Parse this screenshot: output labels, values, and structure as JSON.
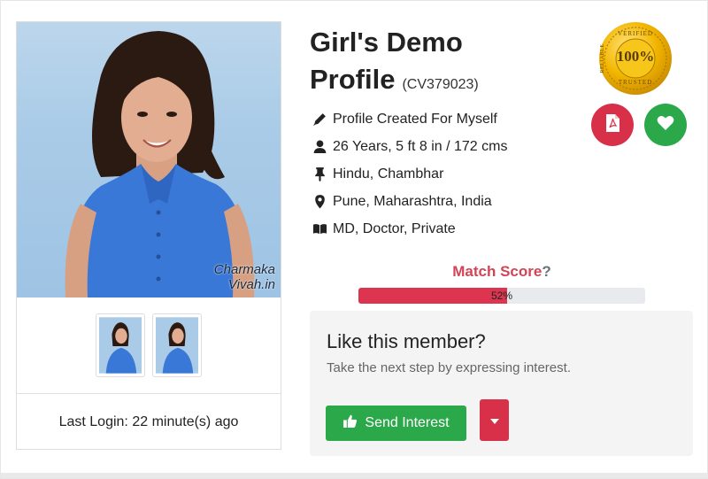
{
  "profile": {
    "name": "Girl's Demo Profile",
    "id": "(CV379023)",
    "photo_watermark_line1": "Charmaka",
    "photo_watermark_line2": "Vivah.in",
    "details": [
      {
        "icon": "pen-icon",
        "text": "Profile Created For Myself"
      },
      {
        "icon": "user-icon",
        "text": "26 Years, 5 ft 8 in / 172 cms"
      },
      {
        "icon": "pin-icon",
        "text": "Hindu, Chambhar"
      },
      {
        "icon": "map-marker-icon",
        "text": "Pune, Maharashtra, India"
      },
      {
        "icon": "book-icon",
        "text": "MD, Doctor, Private"
      }
    ],
    "last_login": "Last Login: 22 minute(s) ago"
  },
  "badge": {
    "top": "VERIFIED",
    "center": "100%",
    "bottom": "TRUSTED",
    "side": "RELIABLE"
  },
  "actions": {
    "pdf_icon": "pdf-icon",
    "favorite_icon": "heart-icon"
  },
  "match": {
    "label": "Match Score",
    "help": "?",
    "percent": 52,
    "percent_text": "52%"
  },
  "interest": {
    "title": "Like this member?",
    "subtitle": "Take the next step by expressing interest.",
    "send_label": "Send Interest",
    "send_icon": "thumbs-up-icon",
    "dropdown_icon": "caret-down-icon"
  },
  "colors": {
    "green": "#2aa84a",
    "red": "#d9304a",
    "match_red": "#d24456",
    "progress_fill": "#dd3550"
  }
}
